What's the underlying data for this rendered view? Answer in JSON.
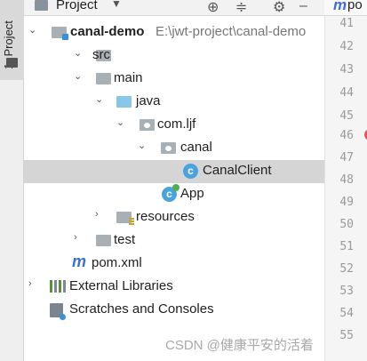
{
  "side": {
    "tab_label": "1: Project"
  },
  "header": {
    "title": "Project"
  },
  "editor": {
    "tab_name": "po",
    "line_numbers": [
      "41",
      "42",
      "43",
      "44",
      "45",
      "46",
      "47",
      "48",
      "49",
      "50",
      "51",
      "52",
      "53",
      "54",
      "55"
    ]
  },
  "tree": {
    "root_name": "canal-demo",
    "root_path": "E:\\jwt-project\\canal-demo",
    "src": "src",
    "main": "main",
    "java": "java",
    "package": "com.ljf",
    "subpackage": "canal",
    "class_selected": "CanalClient",
    "app": "App",
    "resources": "resources",
    "test": "test",
    "pom": "pom.xml",
    "external_libraries": "External Libraries",
    "scratches": "Scratches and Consoles"
  },
  "watermark": "CSDN @健康平安的活着",
  "colors": {
    "selection": "#d5d5d5",
    "folder_blue": "#87c8e8",
    "class_icon": "#4aa3df",
    "breakpoint": "#e05555"
  }
}
